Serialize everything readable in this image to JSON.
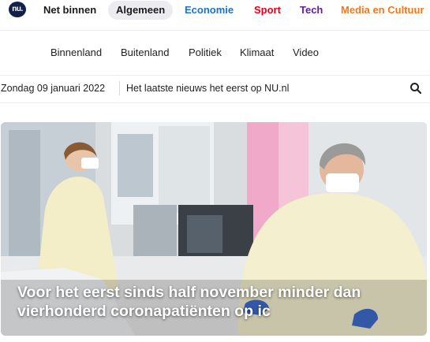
{
  "logo": {
    "text": "nu.nl",
    "color": "#12204a"
  },
  "nav": {
    "tabs": [
      {
        "label": "Net binnen",
        "color": "#1b1b1b"
      },
      {
        "label": "Algemeen",
        "color": "#1b1b1b",
        "active": true
      },
      {
        "label": "Economie",
        "color": "#1a73c9"
      },
      {
        "label": "Sport",
        "color": "#e4001a"
      },
      {
        "label": "Tech",
        "color": "#6a1b9a"
      },
      {
        "label": "Media en Cultuur",
        "color": "#f07a1b"
      }
    ]
  },
  "subnav": {
    "items": [
      "Binnenland",
      "Buitenland",
      "Politiek",
      "Klimaat",
      "Video"
    ]
  },
  "infobar": {
    "date": "Zondag 09 januari 2022",
    "tagline": "Het laatste nieuws het eerst op NU.nl",
    "search_icon": "search-icon"
  },
  "hero": {
    "headline": "Voor het eerst sinds half november minder dan vierhonderd coronapatiënten op ic"
  }
}
